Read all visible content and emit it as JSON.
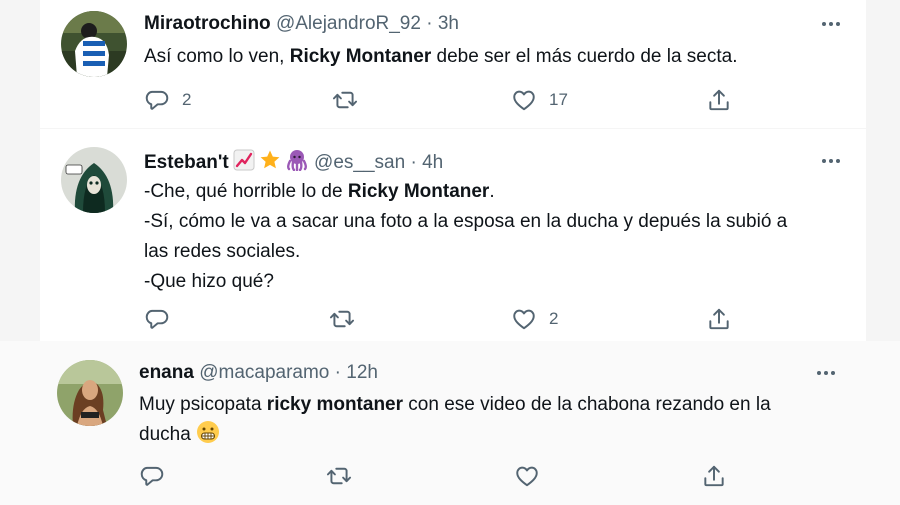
{
  "tweets": [
    {
      "name": "Miraotrochino",
      "handle": "@AlejandroR_92",
      "time": "3h",
      "sep": "·",
      "text": {
        "l1a": "Así como lo ven, ",
        "l1b": "Ricky Montaner",
        "l1c": " debe ser el más cuerdo de la secta."
      },
      "replies": "2",
      "retweets": "",
      "likes": "17"
    },
    {
      "name": "Esteban't",
      "badges": [
        "chart-increasing-emoji",
        "star-emoji",
        "octopus-emoji"
      ],
      "handle": "@es__san",
      "time": "4h",
      "sep": "·",
      "text": {
        "l1a": "-Che, qué horrible lo de ",
        "l1b": "Ricky Montaner",
        "l1c": ".",
        "l2": "-Sí, cómo le va a sacar una foto a la esposa en la ducha y depués la subió a",
        "l3": "las redes sociales.",
        "l4": "-Que hizo qué?"
      },
      "replies": "",
      "retweets": "",
      "likes": "2"
    },
    {
      "name": "enana",
      "handle": "@macaparamo",
      "time": "12h",
      "sep": "·",
      "text": {
        "l1a": "Muy psicopata ",
        "l1b": "ricky montaner",
        "l1c": " con ese video de la chabona rezando en la",
        "l2": "ducha"
      },
      "emoji": "grimacing-face-emoji",
      "replies": "",
      "retweets": "",
      "likes": ""
    }
  ],
  "colors": {
    "text": "#0f1419",
    "secondary": "#536471",
    "background": "#ffffff"
  }
}
